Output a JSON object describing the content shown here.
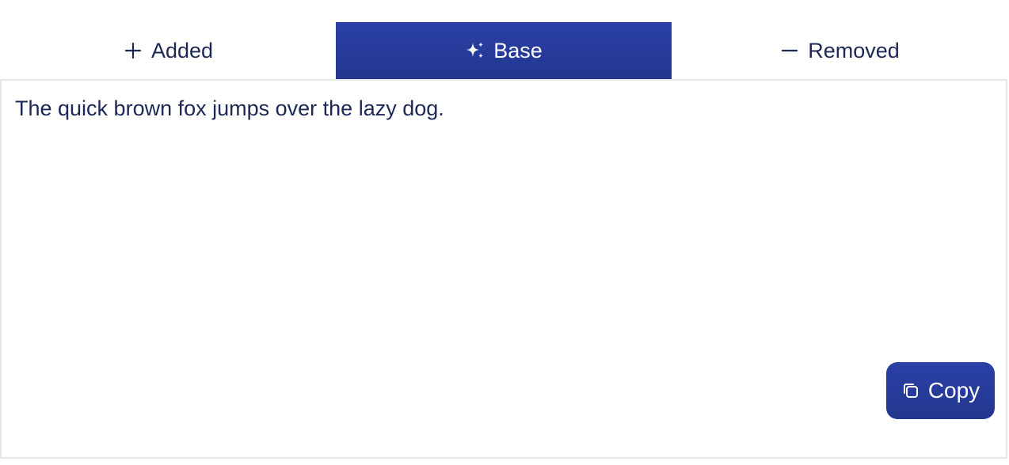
{
  "tabs": [
    {
      "label": "Added",
      "icon": "plus-icon",
      "active": false
    },
    {
      "label": "Base",
      "icon": "sparkles-icon",
      "active": true
    },
    {
      "label": "Removed",
      "icon": "minus-icon",
      "active": false
    }
  ],
  "panel": {
    "text": "The quick brown fox jumps over the lazy dog."
  },
  "copy_button": {
    "label": "Copy",
    "icon": "copy-icon"
  },
  "colors": {
    "accent": "#2a40a6",
    "text": "#1c2855",
    "border": "#e6e6e6"
  }
}
